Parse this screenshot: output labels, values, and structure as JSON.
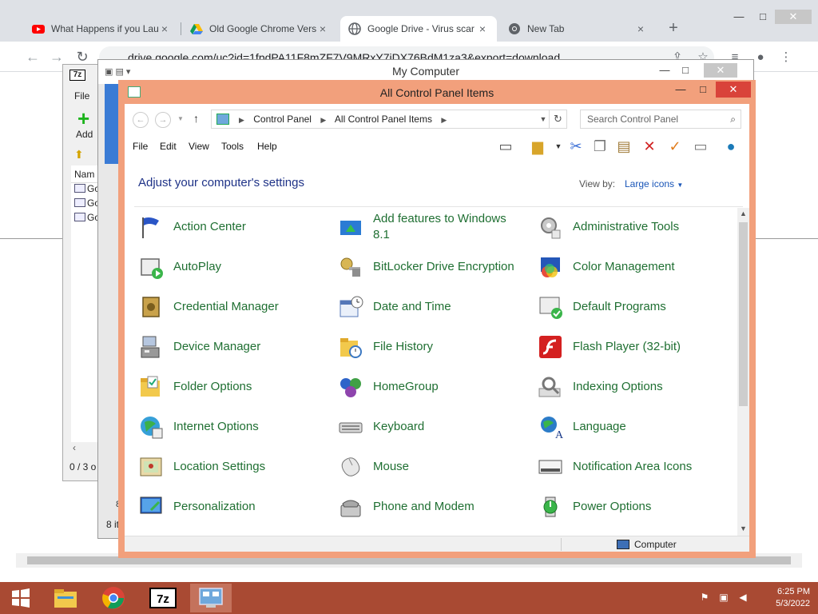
{
  "chrome": {
    "tabs": [
      {
        "label": "What Happens if you Lau",
        "icon": "youtube-icon",
        "active": false
      },
      {
        "label": "Old Google Chrome Vers",
        "icon": "google-drive-icon",
        "active": false
      },
      {
        "label": "Google Drive - Virus scar",
        "icon": "globe-icon",
        "active": true
      },
      {
        "label": "New Tab",
        "icon": "chrome-icon",
        "active": false
      }
    ],
    "url": "drive.google.com/uc?id=1fpdPA11F8mZF7V9MRxY7jDX76BdM1za3&export=download"
  },
  "sevenzip": {
    "logo": "7z",
    "menu": "File",
    "add_label": "Add",
    "column": "Nam",
    "rows": [
      "Go",
      "Go",
      "Go"
    ],
    "status": "0 / 3 o"
  },
  "mycomputer": {
    "title": "My Computer",
    "status": "8 it",
    "partial": "8"
  },
  "controlpanel": {
    "title": "All Control Panel Items",
    "breadcrumb": [
      "Control Panel",
      "All Control Panel Items"
    ],
    "search_placeholder": "Search Control Panel",
    "menu": [
      "File",
      "Edit",
      "View",
      "Tools",
      "Help"
    ],
    "heading": "Adjust your computer's settings",
    "view_by_label": "View by:",
    "view_by_value": "Large icons",
    "status_computer": "Computer",
    "items": [
      {
        "label": "Action Center",
        "icon": "flag-icon"
      },
      {
        "label": "Add features to Windows 8.1",
        "icon": "windows-add-icon"
      },
      {
        "label": "Administrative Tools",
        "icon": "tools-gear-icon"
      },
      {
        "label": "AutoPlay",
        "icon": "autoplay-icon"
      },
      {
        "label": "BitLocker Drive Encryption",
        "icon": "key-lock-icon"
      },
      {
        "label": "Color Management",
        "icon": "color-monitor-icon"
      },
      {
        "label": "Credential Manager",
        "icon": "safe-icon"
      },
      {
        "label": "Date and Time",
        "icon": "calendar-clock-icon"
      },
      {
        "label": "Default Programs",
        "icon": "default-programs-icon"
      },
      {
        "label": "Device Manager",
        "icon": "device-manager-icon"
      },
      {
        "label": "File History",
        "icon": "folder-clock-icon"
      },
      {
        "label": "Flash Player (32-bit)",
        "icon": "flash-icon"
      },
      {
        "label": "Folder Options",
        "icon": "folder-check-icon"
      },
      {
        "label": "HomeGroup",
        "icon": "homegroup-icon"
      },
      {
        "label": "Indexing Options",
        "icon": "indexing-icon"
      },
      {
        "label": "Internet Options",
        "icon": "internet-globe-icon"
      },
      {
        "label": "Keyboard",
        "icon": "keyboard-icon"
      },
      {
        "label": "Language",
        "icon": "language-icon"
      },
      {
        "label": "Location Settings",
        "icon": "location-icon"
      },
      {
        "label": "Mouse",
        "icon": "mouse-icon"
      },
      {
        "label": "Notification Area Icons",
        "icon": "notification-area-icon"
      },
      {
        "label": "Personalization",
        "icon": "personalization-icon"
      },
      {
        "label": "Phone and Modem",
        "icon": "phone-icon"
      },
      {
        "label": "Power Options",
        "icon": "power-icon"
      }
    ]
  },
  "taskbar": {
    "time": "6:25 PM",
    "date": "5/3/2022"
  },
  "colors": {
    "cp_frame": "#f2a07c",
    "taskbar": "#a94a33",
    "item_text": "#1f6f32",
    "heading": "#1e3287"
  }
}
